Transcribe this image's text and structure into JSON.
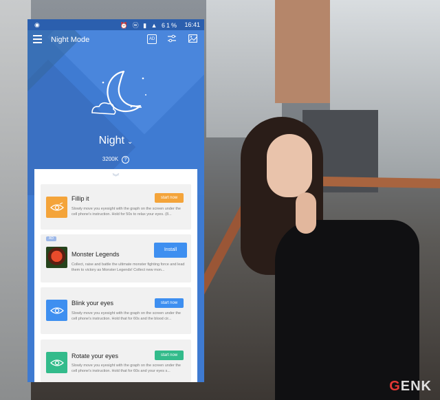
{
  "watermark": {
    "prefix": "G",
    "rest": "ENK"
  },
  "statusbar": {
    "left_icon": "eye-icon",
    "status_icons": "⏰ ⓦ ▮ ▲ 61%",
    "time": "16:41"
  },
  "appbar": {
    "title": "Night Mode",
    "ad_label": "AD",
    "menu_icon": "menu-icon",
    "slider_icon": "slider-icon",
    "image_icon": "image-icon"
  },
  "mode": {
    "name": "Night",
    "temperature": "3200K",
    "help_symbol": "?"
  },
  "sheet": {
    "pull_symbol": "︾"
  },
  "cards": [
    {
      "name": "Fillip it",
      "button": "start now",
      "description": "Slowly move you eyesight with the graph on the screen under the cell phone's instruction. Hold for 50s to relax your eyes. (8...",
      "accent": "#f4a43a",
      "icon": "eye-icon"
    },
    {
      "badge": "AD",
      "name": "Monster Legends",
      "button": "Install",
      "description": "Collect, raise and battle the ultimate monster fighting force and lead them to victory as Monster Legends! Collect new mon...",
      "accent": "#3e8ff0",
      "icon": "monster-legends-app-icon"
    },
    {
      "name": "Blink your eyes",
      "button": "start now",
      "description": "Slowly move you eyesight with the graph on the screen under the cell phone's instruction. Hold that for 60s and the blood cir...",
      "accent": "#3e8ff0",
      "icon": "eye-icon"
    },
    {
      "name": "Rotate your eyes",
      "button": "start now",
      "description": "Slowly move you eyesight with the graph on the screen under the cell phone's instruction. Hold that for 60s and your eyes s...",
      "accent": "#33bb8b",
      "icon": "eye-icon"
    }
  ],
  "colors": {
    "primary": "#3e7ad1",
    "statusbar": "#2b5fae"
  }
}
